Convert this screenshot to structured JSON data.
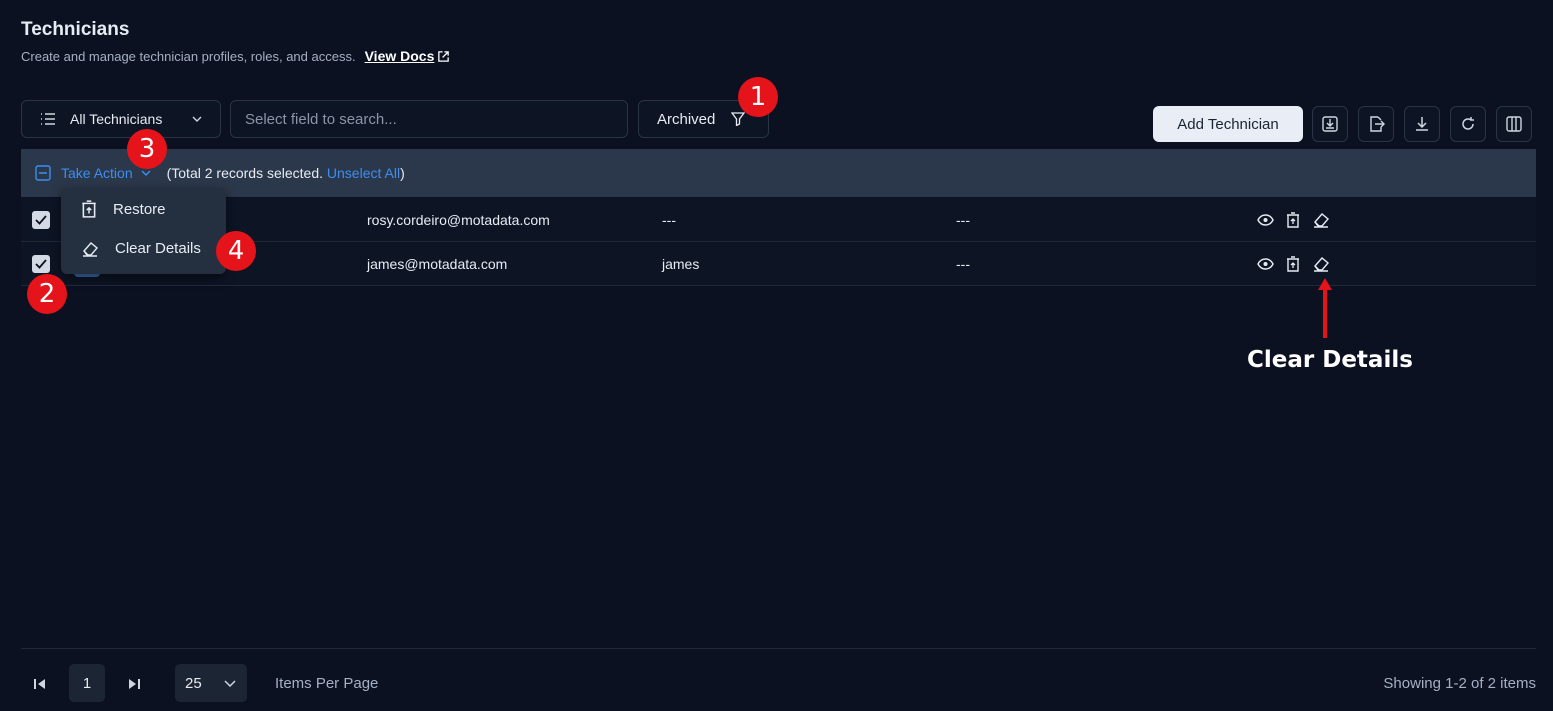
{
  "header": {
    "title": "Technicians",
    "subtitle": "Create and manage technician profiles, roles, and access.",
    "docs_link": "View Docs"
  },
  "toolbar": {
    "view_label": "All Technicians",
    "search_placeholder": "Select field to search...",
    "archived_label": "Archived",
    "add_button": "Add Technician"
  },
  "action_bar": {
    "take_action": "Take Action",
    "selection_prefix": "(Total 2 records selected. ",
    "unselect_all": "Unselect All",
    "selection_suffix": ")"
  },
  "menu": {
    "items": [
      {
        "label": "Restore",
        "icon": "restore-icon"
      },
      {
        "label": "Clear Details",
        "icon": "eraser-icon"
      }
    ]
  },
  "rows": [
    {
      "email": "rosy.cordeiro@motadata.com",
      "col3": "---",
      "col4": "---"
    },
    {
      "email": "james@motadata.com",
      "col3": "james",
      "col4": "---"
    }
  ],
  "annotations": {
    "badges": [
      "1",
      "2",
      "3",
      "4"
    ],
    "label": "Clear Details",
    "color": "#e5141a"
  },
  "footer": {
    "page": "1",
    "per_page": "25",
    "items_per_page_label": "Items Per Page",
    "showing": "Showing 1-2 of 2 items"
  }
}
